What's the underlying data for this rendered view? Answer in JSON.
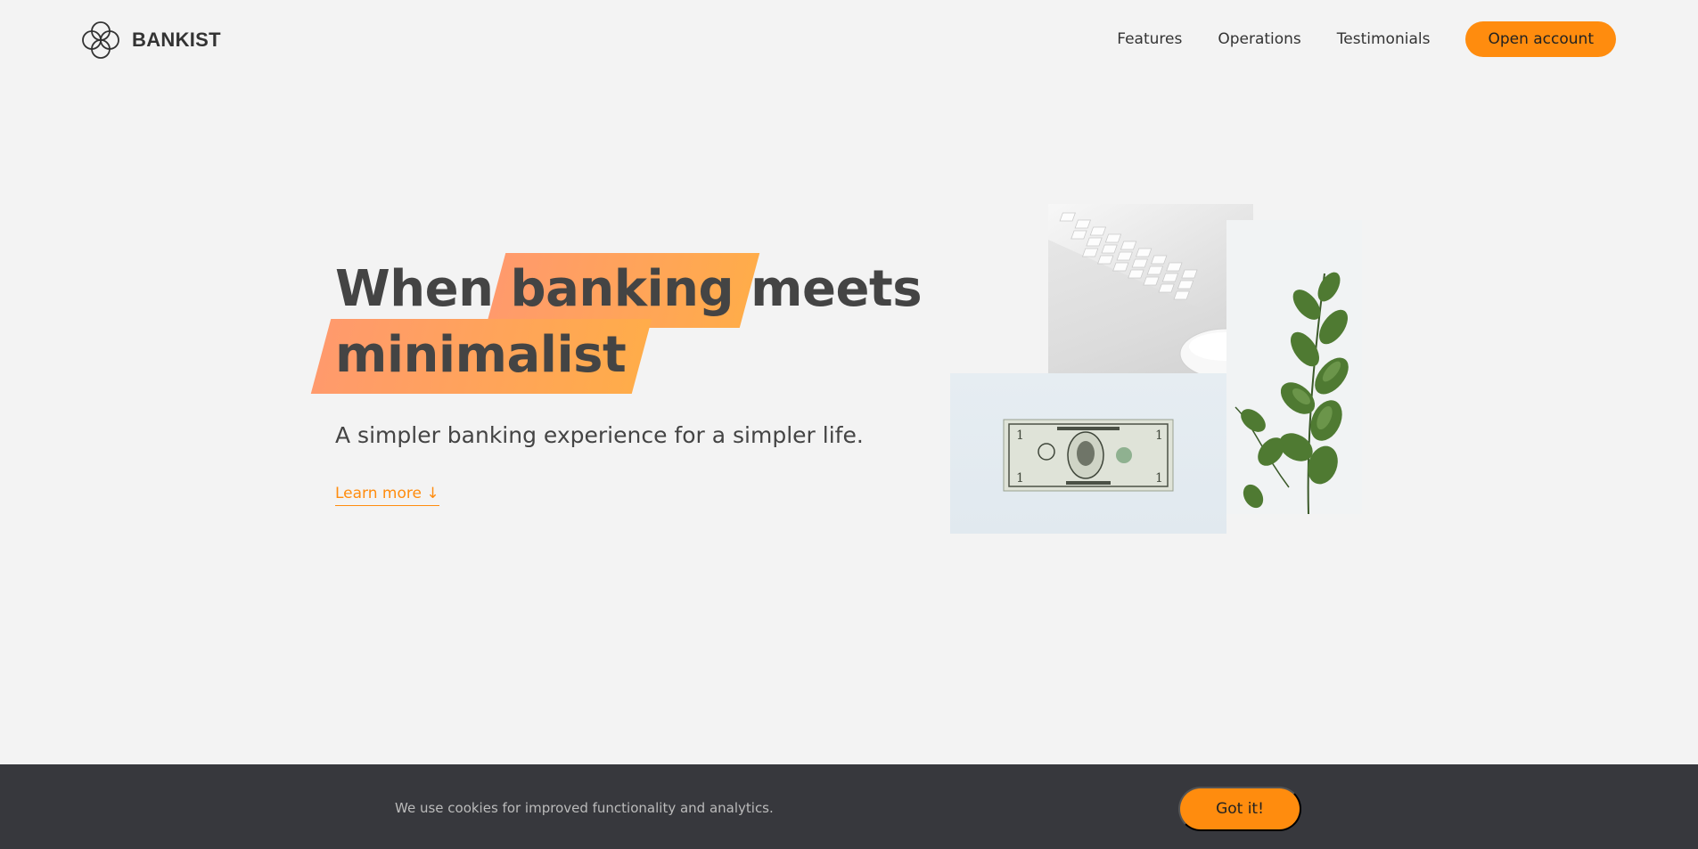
{
  "brand": {
    "name": "BANKIST",
    "icon": "rings-icon"
  },
  "nav": {
    "links": [
      "Features",
      "Operations",
      "Testimonials"
    ],
    "cta": "Open account"
  },
  "hero": {
    "title_part1": "When",
    "title_highlight1": "banking",
    "title_part2": "meets",
    "title_highlight2": "minimalist",
    "subtitle": "A simpler banking experience for a simpler life.",
    "learn_more": "Learn more ↓"
  },
  "images": {
    "keyboard": "keyboard-photo",
    "plant": "plant-photo",
    "dollar": "dollar-bill-photo"
  },
  "cookie": {
    "message": "We use cookies for improved functionality and analytics.",
    "button": "Got it!"
  },
  "colors": {
    "accent": "#ff8c0e",
    "background": "#f3f3f3",
    "cookie_bar": "#37383d",
    "highlight_start": "#ff9a6c",
    "highlight_end": "#ffac4a"
  }
}
